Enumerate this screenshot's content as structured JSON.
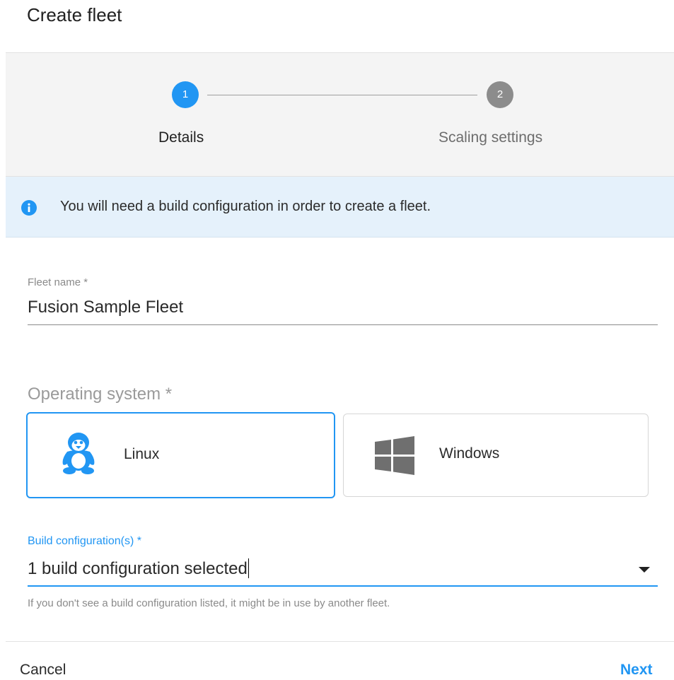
{
  "dialog": {
    "title": "Create fleet"
  },
  "stepper": {
    "steps": [
      {
        "number": "1",
        "label": "Details",
        "active": true
      },
      {
        "number": "2",
        "label": "Scaling settings",
        "active": false
      }
    ]
  },
  "banner": {
    "icon": "info-icon",
    "text": "You will need a build configuration in order to create a fleet."
  },
  "fleet_name": {
    "label": "Fleet name *",
    "value": "Fusion Sample Fleet"
  },
  "operating_system": {
    "label": "Operating system *",
    "options": [
      {
        "name": "Linux",
        "icon": "linux-penguin-icon",
        "selected": true
      },
      {
        "name": "Windows",
        "icon": "windows-logo-icon",
        "selected": false
      }
    ]
  },
  "build_configuration": {
    "label": "Build configuration(s) *",
    "value": "1 build configuration selected",
    "helper": "If you don't see a build configuration listed, it might be in use by another fleet."
  },
  "footer": {
    "cancel_label": "Cancel",
    "next_label": "Next"
  },
  "colors": {
    "accent": "#2196f3",
    "inactive_step": "#8c8c8c",
    "banner_bg": "#e5f1fb",
    "stepper_bg": "#f4f4f4"
  }
}
